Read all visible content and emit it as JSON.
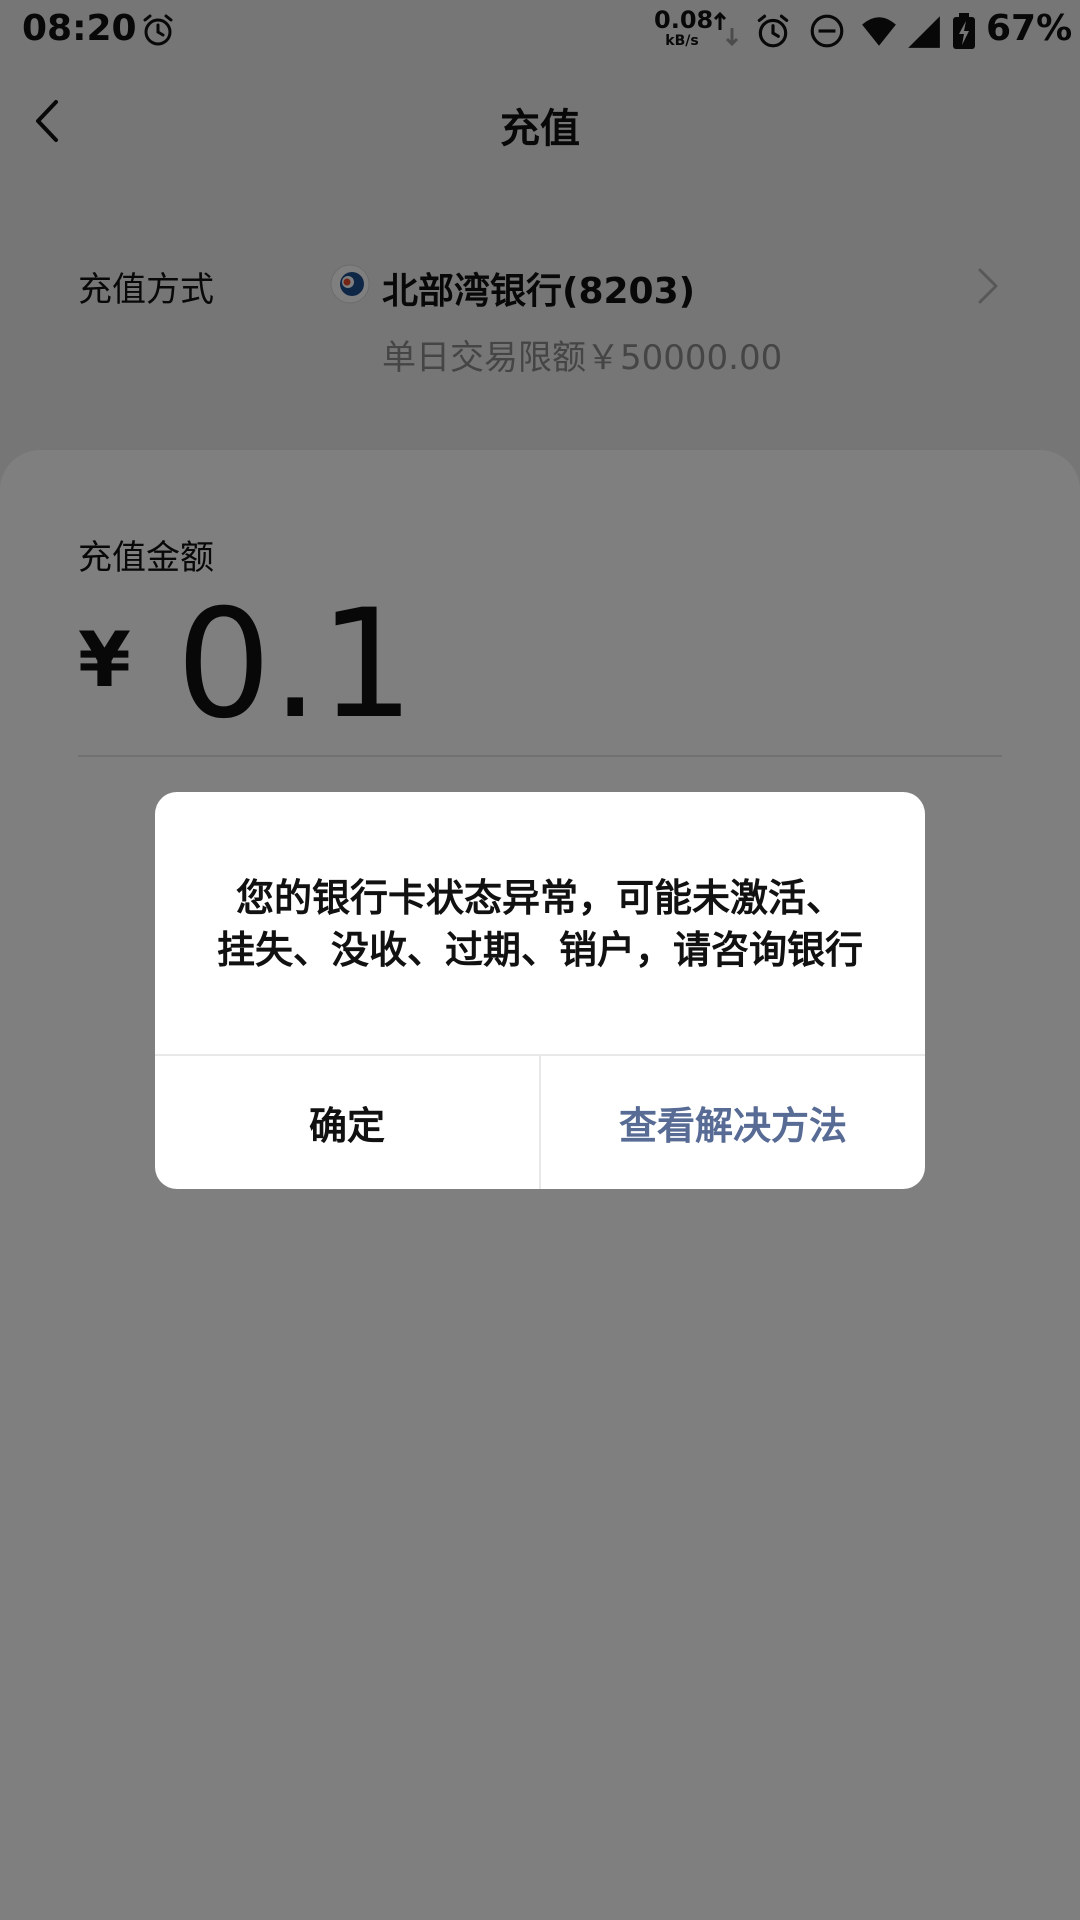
{
  "status_bar": {
    "time": "08:20",
    "net_speed_value": "0.08",
    "net_speed_unit": "kB/s",
    "battery": "67%",
    "icons": [
      "alarm-icon",
      "arrows-icon",
      "alarm-icon",
      "dnd-icon",
      "wifi-icon",
      "signal-icon",
      "battery-charging-icon"
    ]
  },
  "header": {
    "title": "充值",
    "back_icon": "chevron-left-icon"
  },
  "payment_method": {
    "label": "充值方式",
    "bank_name": "北部湾银行(8203)",
    "limit_text": "单日交易限额￥50000.00",
    "chevron_icon": "chevron-right-icon"
  },
  "amount": {
    "label": "充值金额",
    "currency": "¥",
    "value": "0.1"
  },
  "dialog": {
    "message_line1": "您的银行卡状态异常，可能未激活、",
    "message_line2": "挂失、没收、过期、销户，请咨询银行",
    "confirm_label": "确定",
    "solution_label": "查看解决方法"
  },
  "colors": {
    "background": "#ededed",
    "card": "#ffffff",
    "overlay": "rgba(0,0,0,0.5)",
    "link_blue": "#576b95",
    "muted_text": "#8a8a8a"
  }
}
